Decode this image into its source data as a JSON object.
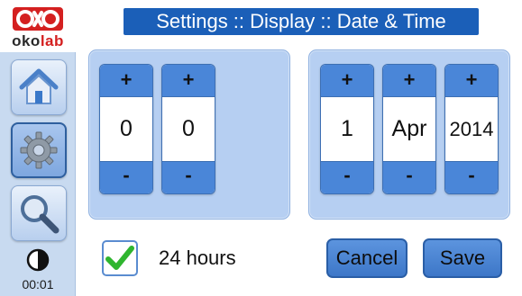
{
  "brand": {
    "oko": "oko",
    "lab": "lab",
    "mark_color": "#d42020"
  },
  "title": "Settings :: Display :: Date & Time",
  "sidebar": {
    "items": [
      {
        "name": "home",
        "icon": "home-icon",
        "active": false
      },
      {
        "name": "settings",
        "icon": "gear-icon",
        "active": true
      },
      {
        "name": "search",
        "icon": "magnifier-icon",
        "active": false
      }
    ],
    "contrast_icon": "contrast-icon",
    "clock": "00:01"
  },
  "time": {
    "hour": {
      "plus": "+",
      "value": "0",
      "minus": "-"
    },
    "minute": {
      "plus": "+",
      "value": "0",
      "minus": "-"
    }
  },
  "date": {
    "day": {
      "plus": "+",
      "value": "1",
      "minus": "-"
    },
    "month": {
      "plus": "+",
      "value": "Apr",
      "minus": "-"
    },
    "year": {
      "plus": "+",
      "value": "2014",
      "minus": "-"
    }
  },
  "format": {
    "label": "24 hours",
    "checked": true
  },
  "actions": {
    "cancel": "Cancel",
    "save": "Save"
  },
  "colors": {
    "accent": "#1b5fb8",
    "button": "#4a86d8",
    "panel": "#b6cff2",
    "check": "#2fb52f"
  }
}
